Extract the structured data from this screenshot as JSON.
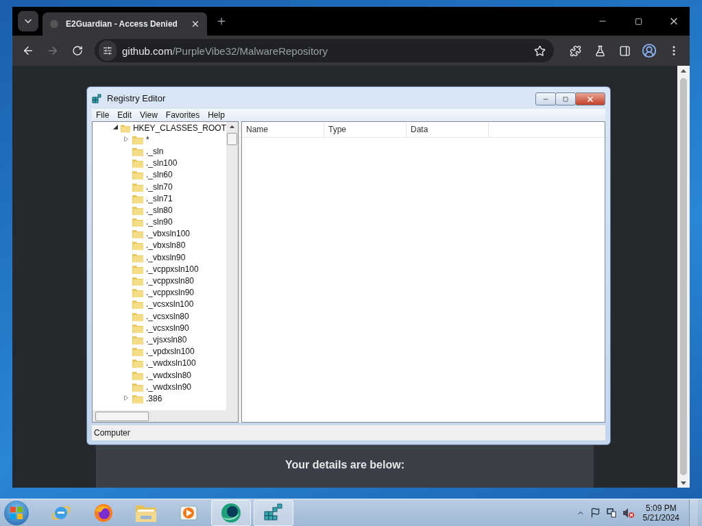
{
  "browser": {
    "tabs": [
      {
        "title": "E2Guardian - Access Denied",
        "selected": true
      }
    ],
    "address": {
      "host": "github.com",
      "path": "/PurpleVibe32/MalwareRepository"
    }
  },
  "page": {
    "heading": "Your details are below:"
  },
  "regedit": {
    "title": "Registry Editor",
    "menu": [
      "File",
      "Edit",
      "View",
      "Favorites",
      "Help"
    ],
    "tree": [
      {
        "label": "HKEY_CLASSES_ROOT",
        "expanded": true,
        "children": [
          {
            "label": "*",
            "expanded": false
          },
          {
            "label": "._sln"
          },
          {
            "label": "._sln100"
          },
          {
            "label": "._sln60"
          },
          {
            "label": "._sln70"
          },
          {
            "label": "._sln71"
          },
          {
            "label": "._sln80"
          },
          {
            "label": "._sln90"
          },
          {
            "label": "._vbxsln100"
          },
          {
            "label": "._vbxsln80"
          },
          {
            "label": "._vbxsln90"
          },
          {
            "label": "._vcppxsln100"
          },
          {
            "label": "._vcppxsln80"
          },
          {
            "label": "._vcppxsln90"
          },
          {
            "label": "._vcsxsln100"
          },
          {
            "label": "._vcsxsln80"
          },
          {
            "label": "._vcsxsln90"
          },
          {
            "label": "._vjsxsln80"
          },
          {
            "label": "._vpdxsln100"
          },
          {
            "label": "._vwdxsln100"
          },
          {
            "label": "._vwdxsln80"
          },
          {
            "label": "._vwdxsln90"
          },
          {
            "label": ".386",
            "expanded": false
          }
        ]
      }
    ],
    "columns": [
      "Name",
      "Type",
      "Data"
    ],
    "status": "Computer"
  },
  "taskbar": {
    "apps": [
      {
        "kind": "ie",
        "running": false
      },
      {
        "kind": "firefox",
        "running": false
      },
      {
        "kind": "folder",
        "running": false
      },
      {
        "kind": "media",
        "running": false
      },
      {
        "kind": "orb",
        "running": true
      },
      {
        "kind": "regedit",
        "running": true
      }
    ],
    "time": "5:09 PM",
    "date": "5/21/2024"
  }
}
